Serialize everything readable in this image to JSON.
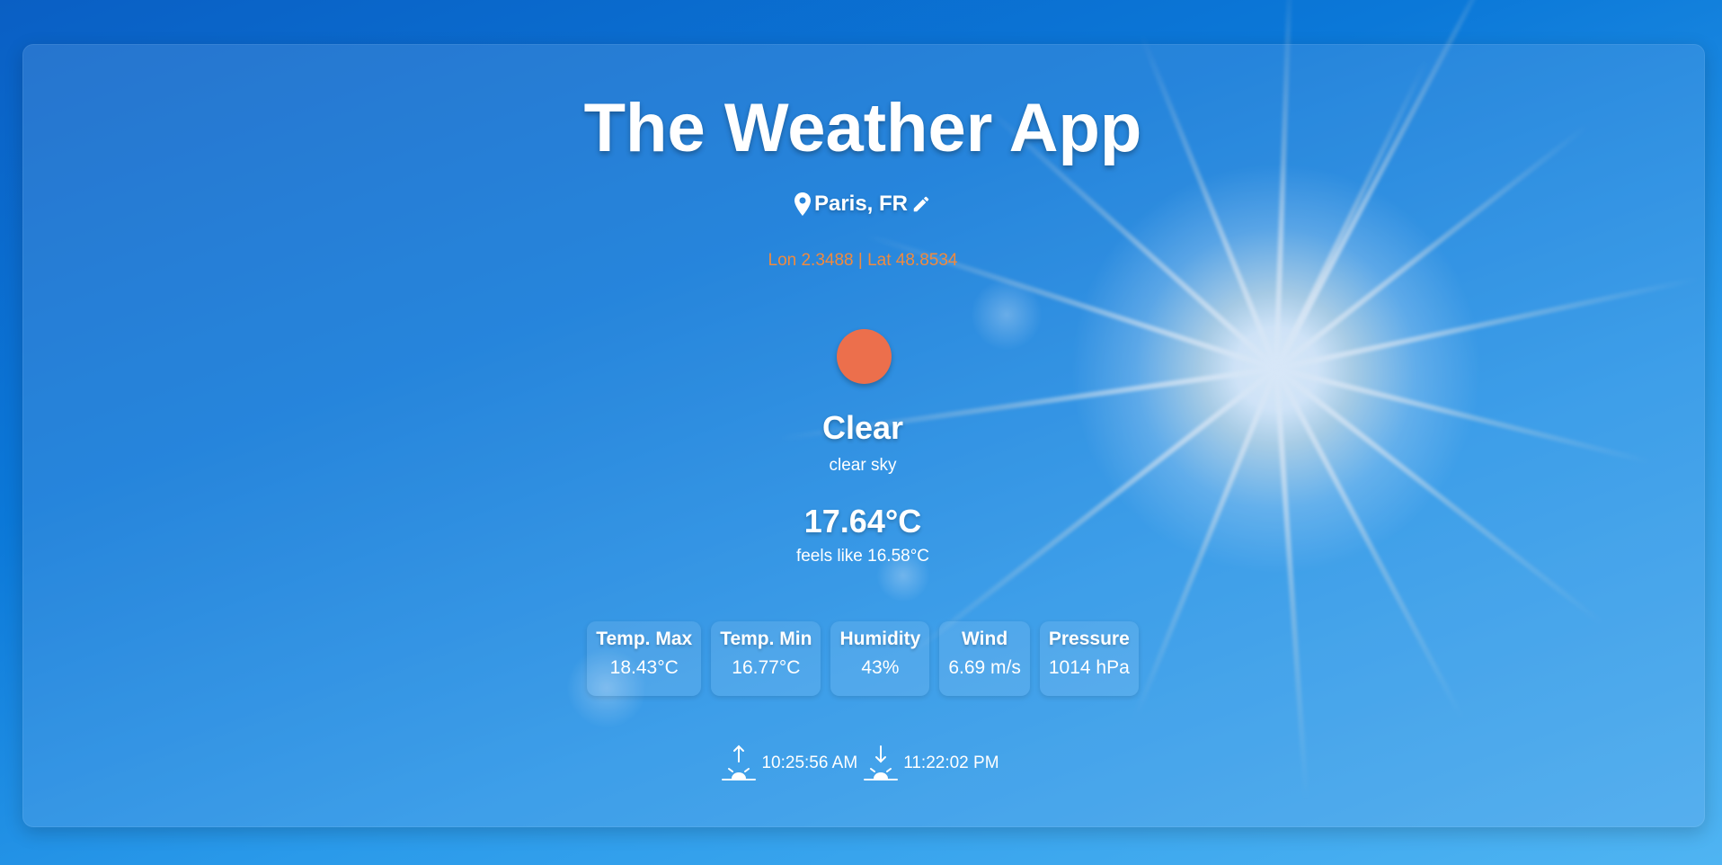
{
  "app": {
    "title": "The Weather App"
  },
  "location": {
    "name": "Paris, FR",
    "coords": "Lon 2.3488 | Lat 48.8534"
  },
  "condition": {
    "main": "Clear",
    "description": "clear sky",
    "icon_color": "#ec6f4c"
  },
  "temperature": {
    "current": "17.64°C",
    "feels_like": "feels like 16.58°C"
  },
  "stats": [
    {
      "label": "Temp. Max",
      "value": "18.43°C"
    },
    {
      "label": "Temp. Min",
      "value": "16.77°C"
    },
    {
      "label": "Humidity",
      "value": "43%"
    },
    {
      "label": "Wind",
      "value": "6.69 m/s"
    },
    {
      "label": "Pressure",
      "value": "1014 hPa"
    }
  ],
  "sun": {
    "sunrise": "10:25:56 AM",
    "sunset": "11:22:02 PM"
  },
  "colors": {
    "coords_accent": "#f08a3e"
  }
}
